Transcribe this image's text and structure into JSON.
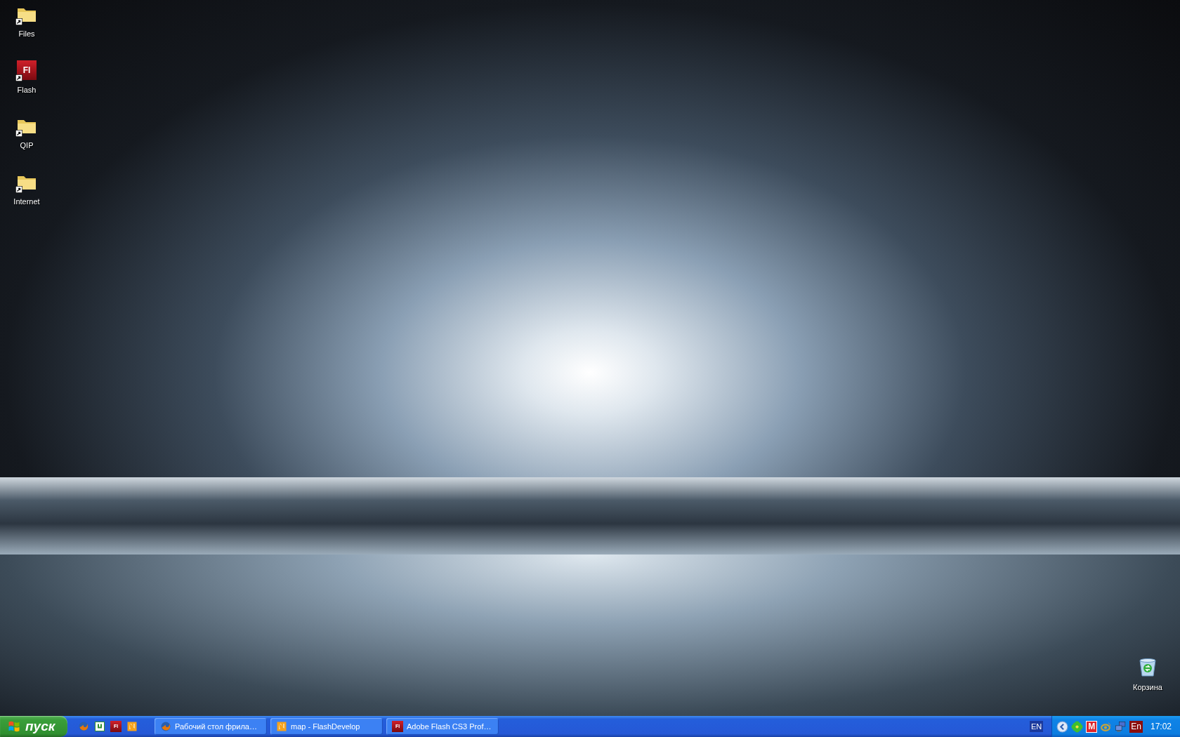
{
  "desktop_icons": [
    {
      "label": "Files",
      "kind": "folder",
      "shortcut": true
    },
    {
      "label": "Flash",
      "kind": "flash",
      "glyph": "Fl",
      "shortcut": true
    },
    {
      "label": "QIP",
      "kind": "folder",
      "shortcut": true
    },
    {
      "label": "Internet",
      "kind": "folder",
      "shortcut": true
    }
  ],
  "recycle_bin": {
    "label": "Корзина"
  },
  "taskbar": {
    "start_button": {
      "label": "пуск"
    },
    "quick_launch": [
      {
        "kind": "firefox"
      },
      {
        "kind": "torrent"
      },
      {
        "kind": "flash",
        "glyph": "Fl"
      },
      {
        "kind": "flashdevelop"
      }
    ],
    "window_buttons": [
      {
        "label": "Рабочий стол фрила…",
        "kind": "firefox",
        "selected": false
      },
      {
        "label": "map - FlashDevelop",
        "kind": "flashdevelop",
        "selected": false
      },
      {
        "label": "Adobe Flash CS3 Prof…",
        "kind": "flash",
        "glyph": "Fl",
        "selected": false
      }
    ],
    "language": "EN",
    "tray_icons": [
      {
        "kind": "back"
      },
      {
        "kind": "flower"
      },
      {
        "kind": "letter",
        "glyph": "M"
      },
      {
        "kind": "satellite"
      },
      {
        "kind": "network"
      },
      {
        "kind": "letter",
        "glyph": "En"
      }
    ],
    "clock": "17:02"
  }
}
